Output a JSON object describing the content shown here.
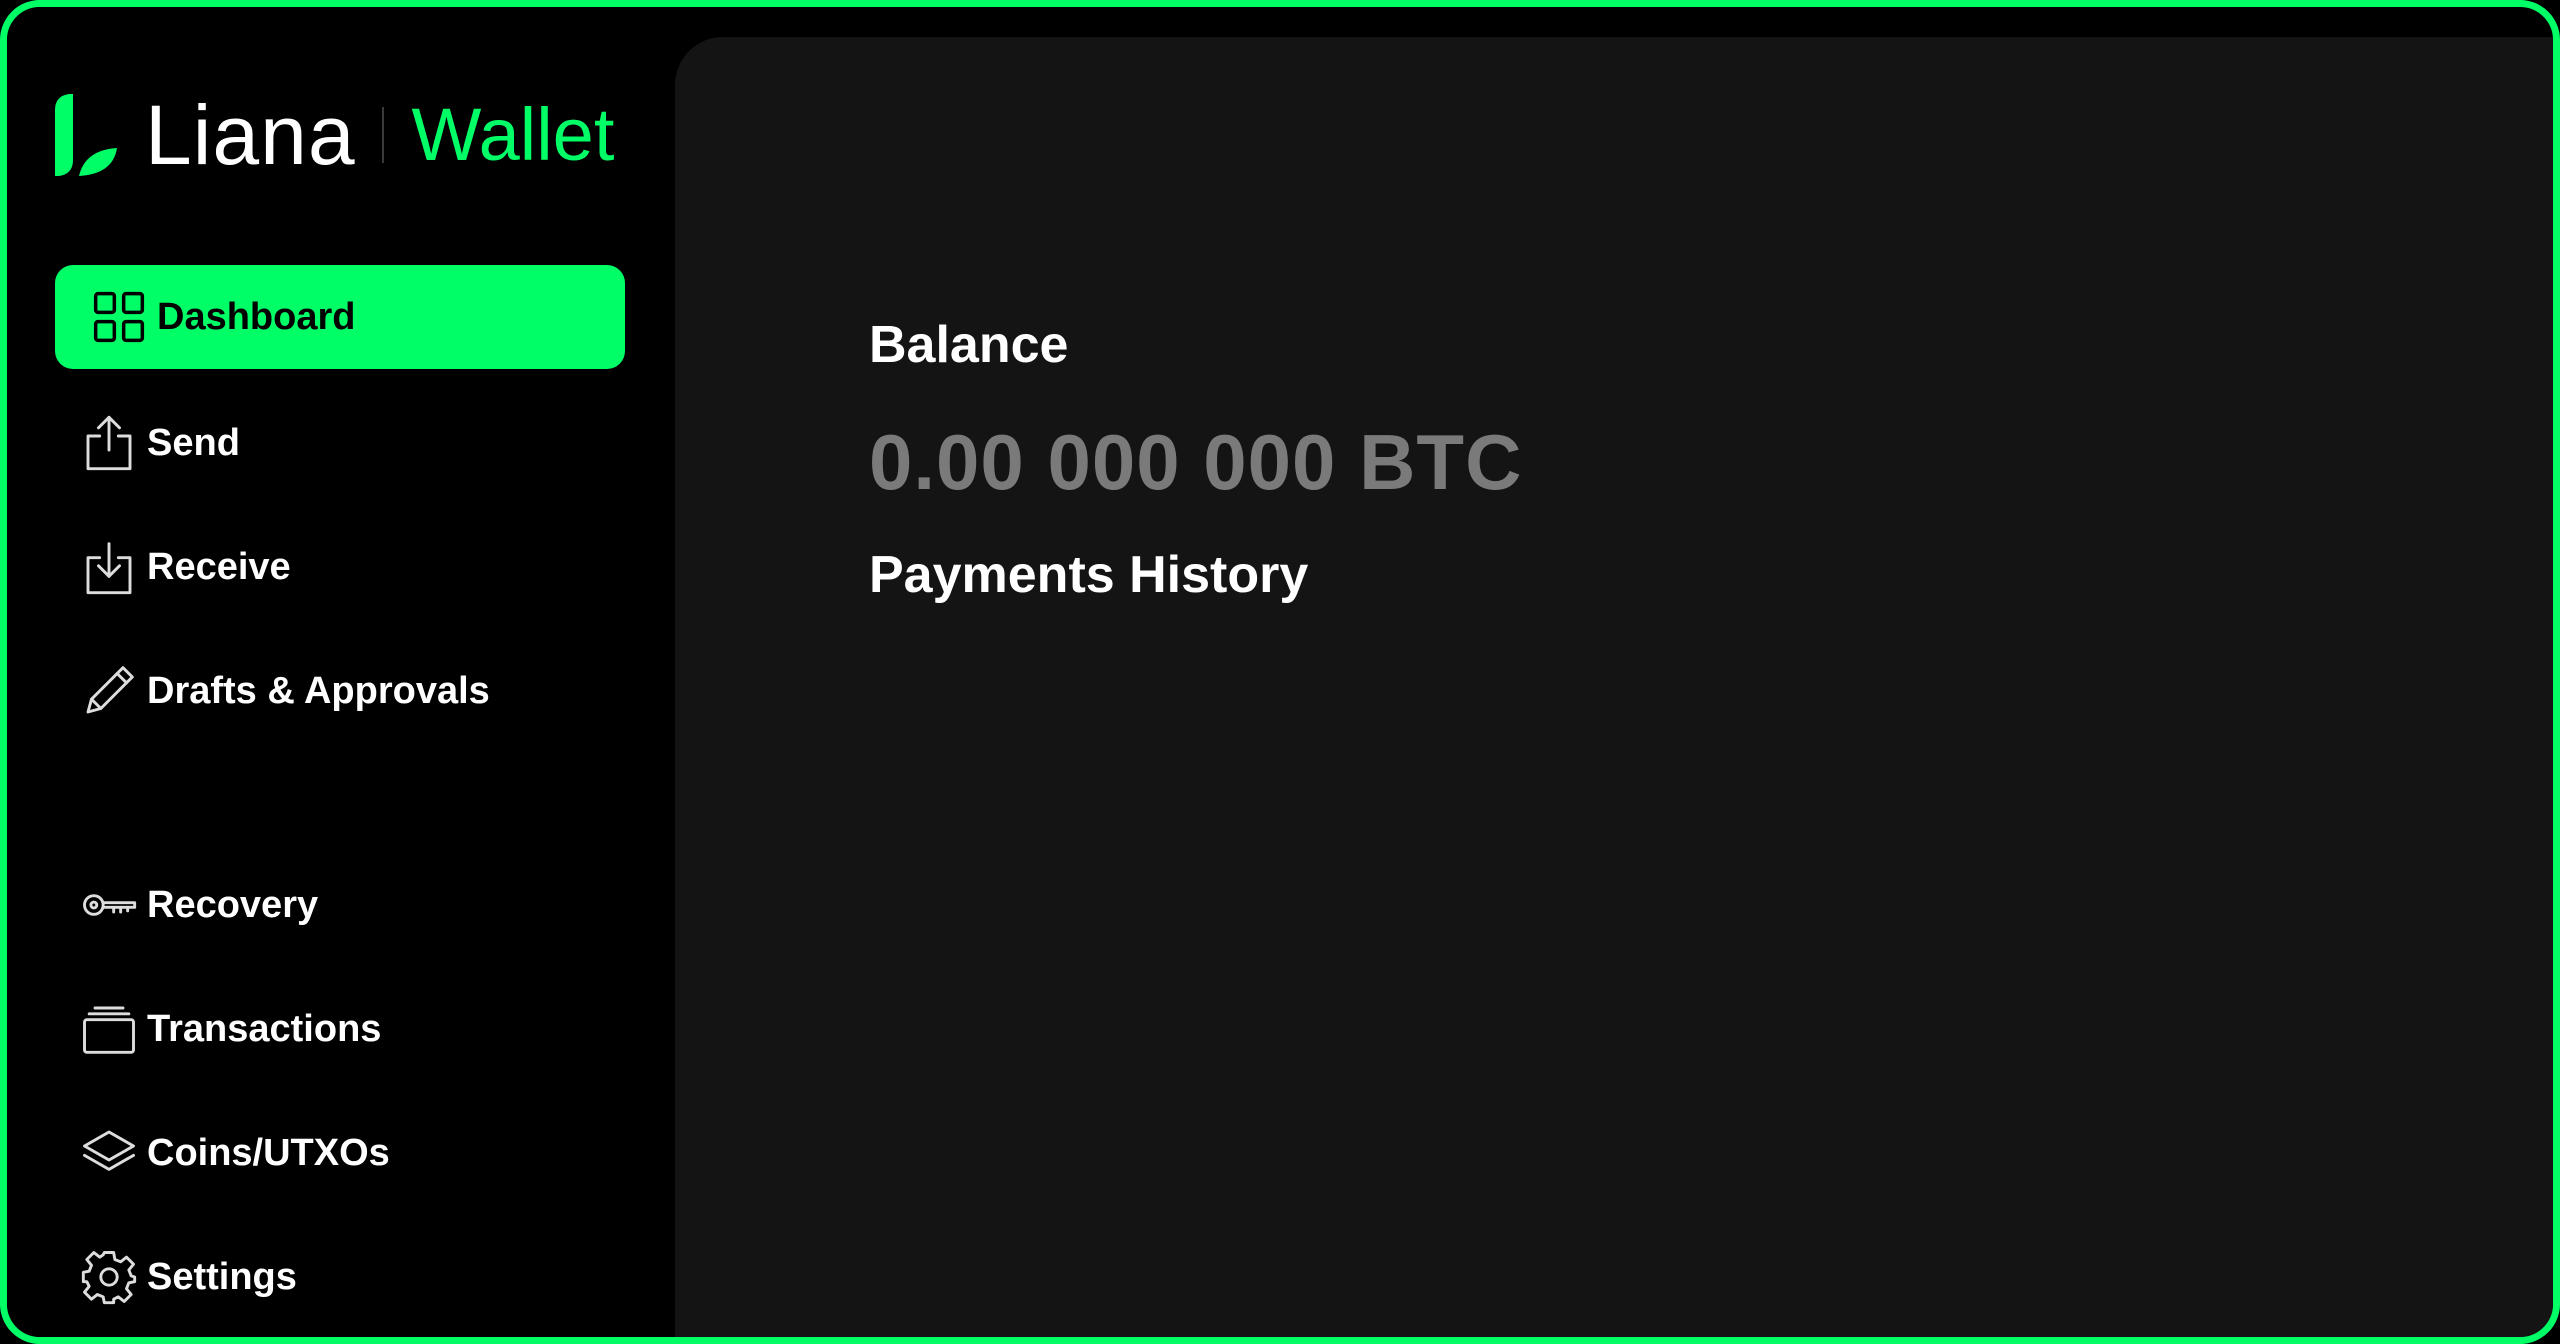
{
  "app": {
    "logo_word": "Liana",
    "logo_sub": "Wallet",
    "accent_color": "#00ff66"
  },
  "sidebar": {
    "items": [
      {
        "label": "Dashboard",
        "icon": "grid-icon",
        "active": true
      },
      {
        "label": "Send",
        "icon": "upload-icon"
      },
      {
        "label": "Receive",
        "icon": "download-icon"
      },
      {
        "label": "Drafts & Approvals",
        "icon": "pencil-icon"
      },
      {
        "label": "Recovery",
        "icon": "key-icon"
      },
      {
        "label": "Transactions",
        "icon": "stack-icon"
      },
      {
        "label": "Coins/UTXOs",
        "icon": "layers-icon"
      },
      {
        "label": "Settings",
        "icon": "gear-icon"
      }
    ]
  },
  "main": {
    "balance_title": "Balance",
    "balance_value": "0.00 000 000 BTC",
    "payments_title": "Payments History"
  }
}
